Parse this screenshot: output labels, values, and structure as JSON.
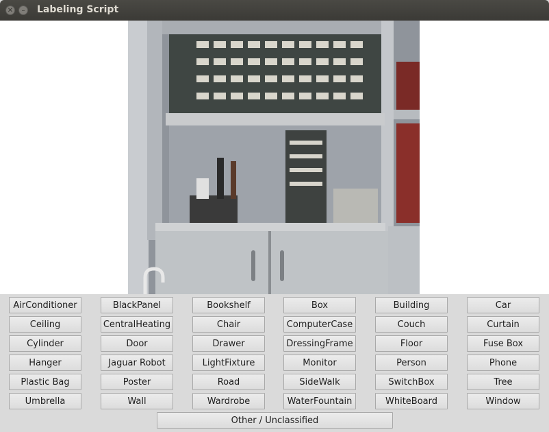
{
  "window": {
    "title": "Labeling Script"
  },
  "labels": [
    "AirConditioner",
    "BlackPanel",
    "Bookshelf",
    "Box",
    "Building",
    "Car",
    "Ceiling",
    "CentralHeating",
    "Chair",
    "ComputerCase",
    "Couch",
    "Curtain",
    "Cylinder",
    "Door",
    "Drawer",
    "DressingFrame",
    "Floor",
    "Fuse Box",
    "Hanger",
    "Jaguar Robot",
    "LightFixture",
    "Monitor",
    "Person",
    "Phone",
    "Plastic Bag",
    "Poster",
    "Road",
    "SideWalk",
    "SwitchBox",
    "Tree",
    "Umbrella",
    "Wall",
    "Wardrobe",
    "WaterFountain",
    "WhiteBoard",
    "Window"
  ],
  "other_label": "Other / Unclassified"
}
